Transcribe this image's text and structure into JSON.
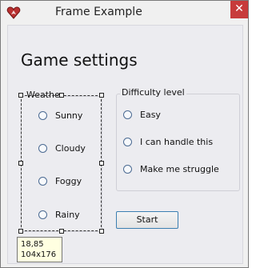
{
  "window": {
    "title": "Frame Example",
    "close_glyph": "✕",
    "icon": "heart-app-icon"
  },
  "page": {
    "heading": "Game settings"
  },
  "weather": {
    "label": "Weather",
    "options": [
      "Sunny",
      "Cloudy",
      "Foggy",
      "Rainy"
    ]
  },
  "difficulty": {
    "label": "Difficulty level",
    "options": [
      "Easy",
      "I can handle this",
      "Make me struggle"
    ]
  },
  "start_button": {
    "label": "Start"
  },
  "tooltip": {
    "position_text": "18,85",
    "size_text": "104x176"
  },
  "colors": {
    "close_button": "#c73b3b",
    "button_border": "#3c7fb1",
    "tooltip_bg": "#ffffe1"
  }
}
